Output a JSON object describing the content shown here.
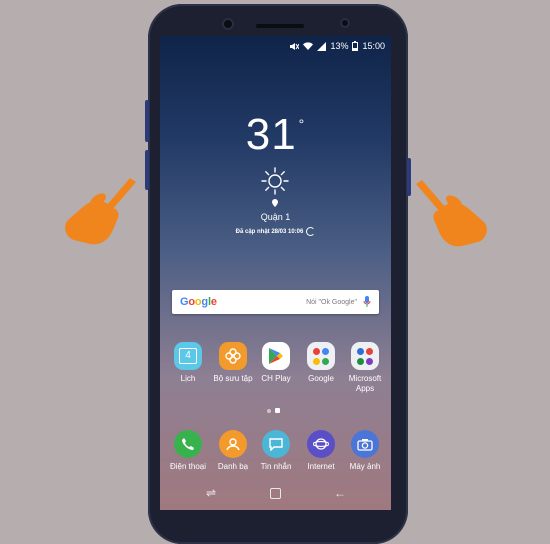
{
  "status_bar": {
    "battery": "13%",
    "time": "15:00"
  },
  "weather": {
    "temperature": "31",
    "degree": "°",
    "city": "Quận 1",
    "updated": "Đã cập nhật 28/03 10:06"
  },
  "search": {
    "logo": "Google",
    "placeholder": "Nói \"Ok Google\""
  },
  "apps": [
    {
      "label": "Lịch",
      "icon": "calendar-icon",
      "badge": "4"
    },
    {
      "label": "Bộ sưu tập",
      "icon": "gallery-icon"
    },
    {
      "label": "CH Play",
      "icon": "play-store-icon"
    },
    {
      "label": "Google",
      "icon": "google-folder-icon"
    },
    {
      "label": "Microsoft Apps",
      "icon": "microsoft-folder-icon"
    }
  ],
  "dock": [
    {
      "label": "Điện thoại",
      "icon": "phone-icon"
    },
    {
      "label": "Danh bạ",
      "icon": "contacts-icon"
    },
    {
      "label": "Tin nhắn",
      "icon": "messages-icon"
    },
    {
      "label": "Internet",
      "icon": "internet-icon"
    },
    {
      "label": "Máy ảnh",
      "icon": "camera-icon"
    }
  ],
  "navigation": {
    "recent": "recent-apps-icon",
    "home": "home-icon",
    "back": "back-icon"
  },
  "colors": {
    "background": "#b6aeae",
    "phone_body": "#1c2030",
    "hand": "#f0851e"
  }
}
